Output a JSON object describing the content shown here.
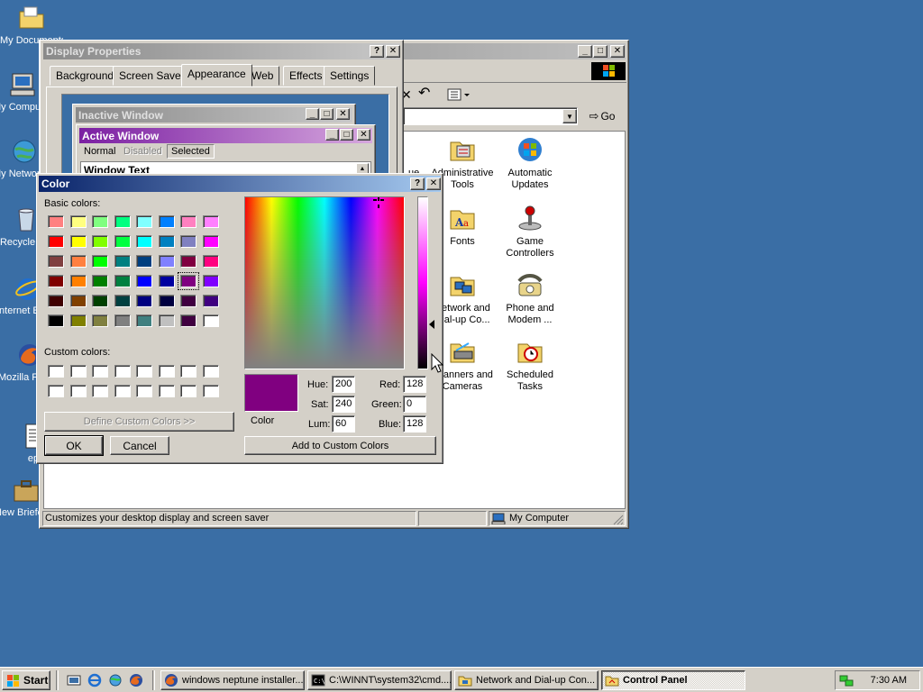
{
  "desktop": {
    "icons": [
      {
        "label": "My Documents"
      },
      {
        "label": "My Computer"
      },
      {
        "label": "My Network Places"
      },
      {
        "label": "Recycle Bin"
      },
      {
        "label": "Internet Explorer"
      },
      {
        "label": "Mozilla Firefox"
      },
      {
        "label": "ep"
      },
      {
        "label": "New Briefcase"
      }
    ]
  },
  "control_panel": {
    "title": "Control Panel",
    "go_label": "Go",
    "status_left": "Customizes your desktop display and screen saver",
    "status_right": "My Computer",
    "icons": [
      {
        "label": "Administrative Tools"
      },
      {
        "label": "Automatic Updates"
      },
      {
        "label": "Fonts"
      },
      {
        "label": "Game Controllers"
      },
      {
        "label": "Network and Dial-up Co..."
      },
      {
        "label": "Phone and Modem ..."
      },
      {
        "label": "Scanners and Cameras"
      },
      {
        "label": "Scheduled Tasks"
      }
    ],
    "partial_label": "ue"
  },
  "display_properties": {
    "title": "Display Properties",
    "tabs": [
      "Background",
      "Screen Saver",
      "Appearance",
      "Web",
      "Effects",
      "Settings"
    ],
    "active_tab": "Appearance",
    "preview": {
      "inactive_title": "Inactive Window",
      "active_title": "Active Window",
      "menu": [
        "Normal",
        "Disabled",
        "Selected"
      ],
      "window_text": "Window Text"
    }
  },
  "color_dialog": {
    "title": "Color",
    "basic_colors_label": "Basic colors:",
    "custom_colors_label": "Custom colors:",
    "define_custom_label": "Define Custom Colors >>",
    "ok_label": "OK",
    "cancel_label": "Cancel",
    "add_custom_label": "Add to Custom Colors",
    "color_solid_label": "Color",
    "hue_label": "Hue:",
    "sat_label": "Sat:",
    "lum_label": "Lum:",
    "red_label": "Red:",
    "green_label": "Green:",
    "blue_label": "Blue:",
    "hue": "200",
    "sat": "240",
    "lum": "60",
    "red": "128",
    "green": "0",
    "blue": "128",
    "selected_color": "#800080",
    "basic_colors": [
      [
        "#ff8080",
        "#ffff80",
        "#80ff80",
        "#00ff80",
        "#80ffff",
        "#0080ff",
        "#ff80c0",
        "#ff80ff"
      ],
      [
        "#ff0000",
        "#ffff00",
        "#80ff00",
        "#00ff40",
        "#00ffff",
        "#0080c0",
        "#8080c0",
        "#ff00ff"
      ],
      [
        "#804040",
        "#ff8040",
        "#00ff00",
        "#008080",
        "#004080",
        "#8080ff",
        "#800040",
        "#ff0080"
      ],
      [
        "#800000",
        "#ff8000",
        "#008000",
        "#008040",
        "#0000ff",
        "#0000a0",
        "#800080",
        "#8000ff"
      ],
      [
        "#400000",
        "#804000",
        "#004000",
        "#004040",
        "#000080",
        "#000040",
        "#400040",
        "#400080"
      ],
      [
        "#000000",
        "#808000",
        "#808040",
        "#808080",
        "#408080",
        "#c0c0c0",
        "#400040",
        "#ffffff"
      ]
    ]
  },
  "taskbar": {
    "start_label": "Start",
    "tasks": [
      {
        "label": "windows neptune installer..."
      },
      {
        "label": "C:\\WINNT\\system32\\cmd...."
      },
      {
        "label": "Network and Dial-up Con..."
      },
      {
        "label": "Control Panel"
      }
    ],
    "clock": "7:30 AM"
  }
}
